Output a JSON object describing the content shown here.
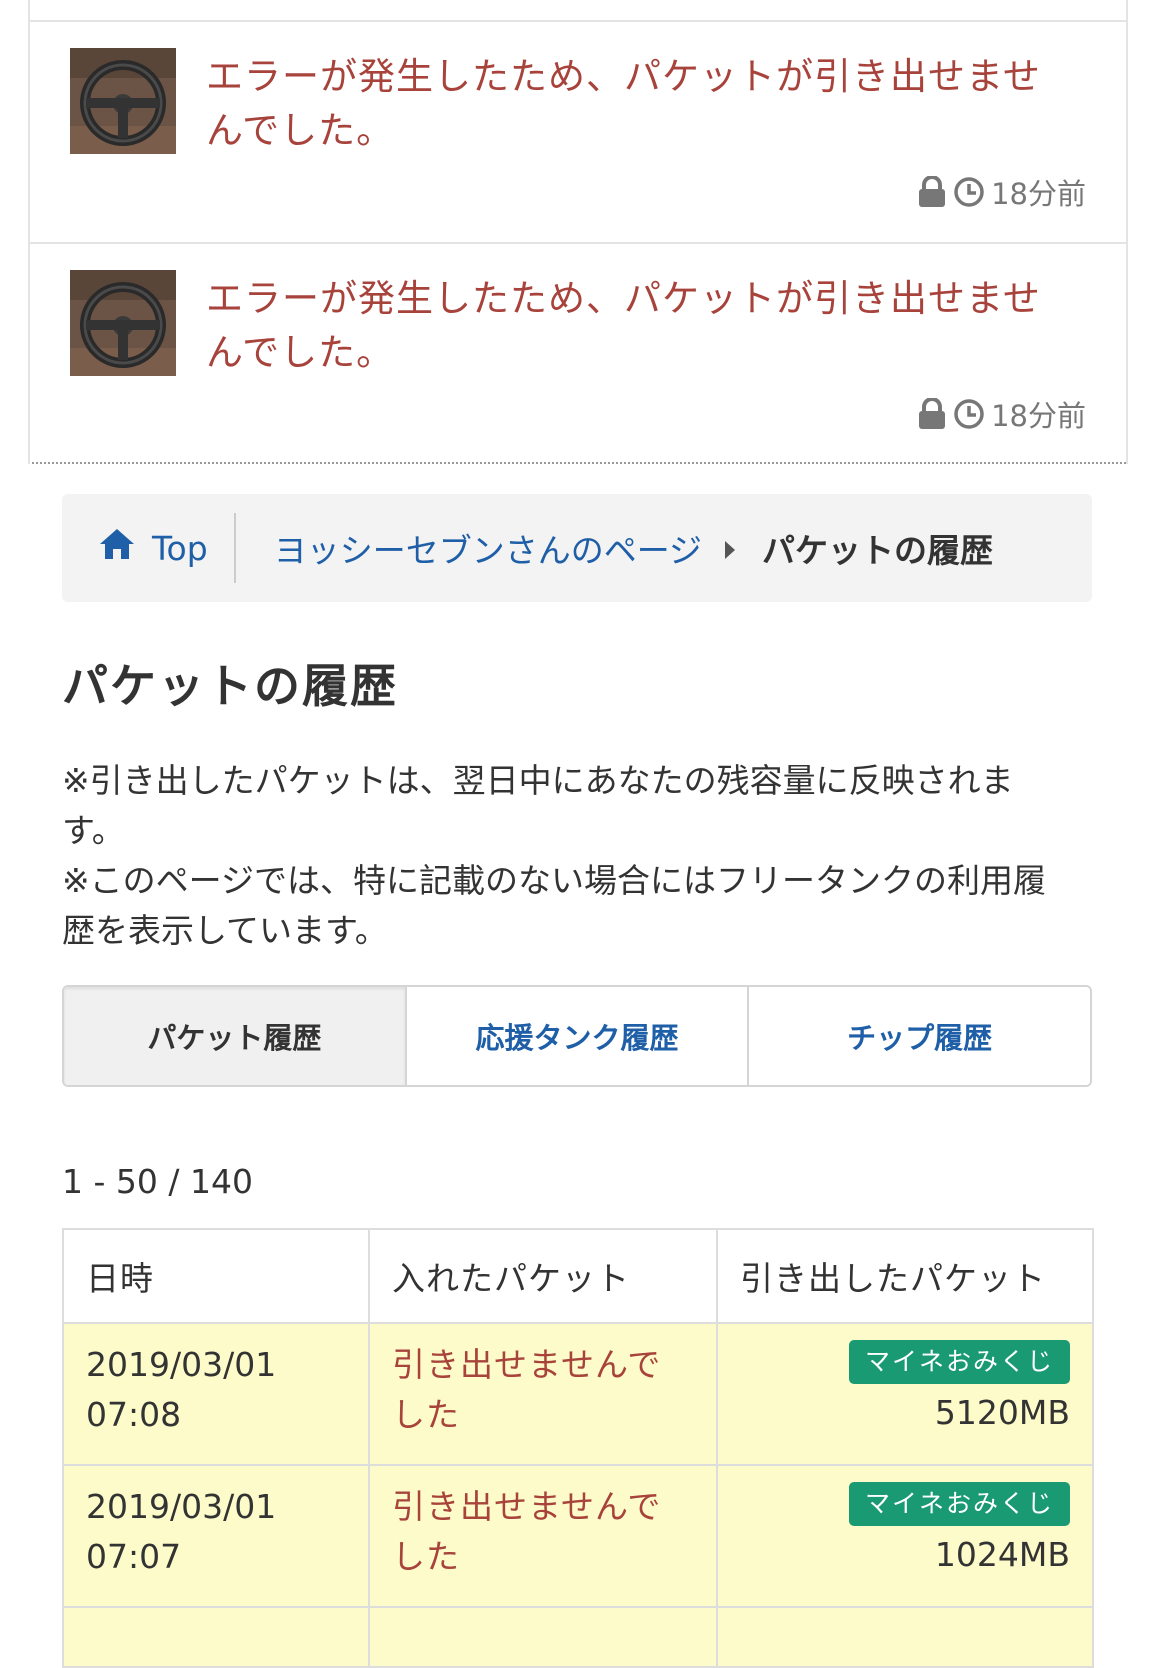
{
  "notifications": [
    {
      "message": "エラーが発生したため、パケットが引き出せませんでした。",
      "time": "18分前"
    },
    {
      "message": "エラーが発生したため、パケットが引き出せませんでした。",
      "time": "18分前"
    }
  ],
  "breadcrumb": {
    "home_label": "Top",
    "parent_label": "ヨッシーセブンさんのページ",
    "current_label": "パケットの履歴"
  },
  "page": {
    "title": "パケットの履歴",
    "notice_1": "※引き出したパケットは、翌日中にあなたの残容量に反映されます。",
    "notice_2": "※このページでは、特に記載のない場合にはフリータンクの利用履歴を表示しています。"
  },
  "tabs": [
    {
      "label": "パケット履歴",
      "active": true
    },
    {
      "label": "応援タンク履歴",
      "active": false
    },
    {
      "label": "チップ履歴",
      "active": false
    }
  ],
  "pagination": {
    "range": "1 - 50 / 140"
  },
  "table": {
    "headers": [
      "日時",
      "入れたパケット",
      "引き出したパケット"
    ],
    "rows": [
      {
        "date": "2019/03/01",
        "time": "07:08",
        "status": "引き出せませんでした",
        "badge": "マイネおみくじ",
        "amount": "5120MB"
      },
      {
        "date": "2019/03/01",
        "time": "07:07",
        "status": "引き出せませんでした",
        "badge": "マイネおみくじ",
        "amount": "1024MB"
      }
    ]
  },
  "colors": {
    "error_text": "#a8433c",
    "link": "#1f5fa7",
    "badge": "#1a9a72",
    "row_highlight": "#fcfbc9"
  }
}
